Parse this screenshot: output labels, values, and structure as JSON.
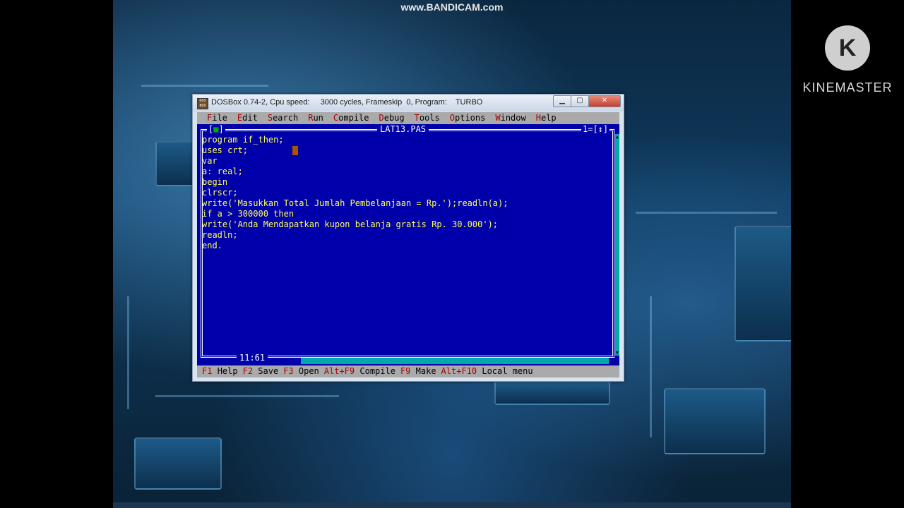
{
  "overlay": {
    "recorder_watermark": "www.BANDICAM.com",
    "editor_logo_letter": "K",
    "editor_watermark": "KINEMASTER"
  },
  "window": {
    "title": "DOSBox 0.74-2, Cpu speed:     3000 cycles, Frameskip  0, Program:    TURBO",
    "icon_text": "DOS BOX",
    "minimize_icon": "minimize-icon",
    "maximize_icon": "maximize-icon",
    "close_icon": "close-icon"
  },
  "menubar": {
    "items": [
      {
        "hotkey": "F",
        "rest": "ile"
      },
      {
        "hotkey": "E",
        "rest": "dit"
      },
      {
        "hotkey": "S",
        "rest": "earch"
      },
      {
        "hotkey": "R",
        "rest": "un"
      },
      {
        "hotkey": "C",
        "rest": "ompile"
      },
      {
        "hotkey": "D",
        "rest": "ebug"
      },
      {
        "hotkey": "T",
        "rest": "ools"
      },
      {
        "hotkey": "O",
        "rest": "ptions"
      },
      {
        "hotkey": "W",
        "rest": "indow"
      },
      {
        "hotkey": "H",
        "rest": "elp"
      }
    ]
  },
  "editor": {
    "filename": "LAT13.PAS",
    "close_box_left": "[",
    "close_box_mark": "■",
    "close_box_right": "]",
    "window_number": "1=[↕]",
    "cursor_position": "11:61",
    "code_lines": [
      "program if_then;",
      "uses crt;",
      "var",
      "a: real;",
      "begin",
      "clrscr;",
      "write('Masukkan Total Jumlah Pembelanjaan = Rp.');readln(a);",
      "if a > 300000 then",
      "write('Anda Mendapatkan kupon belanja gratis Rp. 30.000');",
      "readln;",
      "end."
    ]
  },
  "statusbar": {
    "items": [
      {
        "key": "F1",
        "label": "Help"
      },
      {
        "key": "F2",
        "label": "Save"
      },
      {
        "key": "F3",
        "label": "Open"
      },
      {
        "key": "Alt+F9",
        "label": "Compile"
      },
      {
        "key": "F9",
        "label": "Make"
      },
      {
        "key": "Alt+F10",
        "label": "Local menu"
      }
    ]
  },
  "colors": {
    "editor_bg": "#0000aa",
    "code_text": "#ffff55",
    "menu_bg": "#aaaaaa",
    "hotkey": "#aa0000",
    "scrollbar": "#00aaaa"
  }
}
